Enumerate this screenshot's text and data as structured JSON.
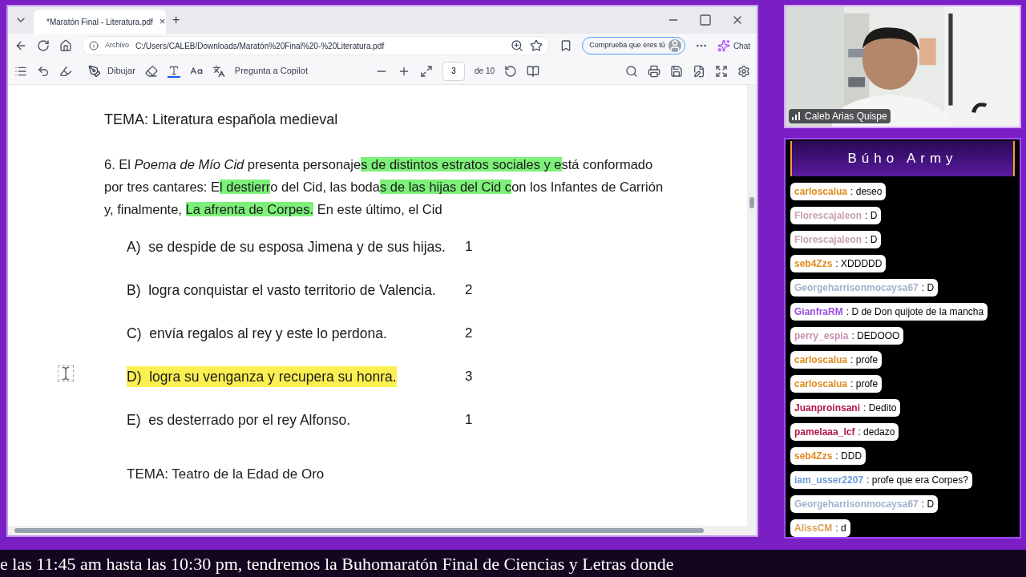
{
  "browser": {
    "tab": {
      "title": "*Maratón Final - Literatura.pdf",
      "close": "×"
    },
    "new_tab": "+",
    "address": {
      "label": "Archivo",
      "url": "C:/Users/CALEB/Downloads/Maratón%20Final%20-%20Literatura.pdf"
    },
    "verify_button": "Comprueba que eres tú",
    "chat_button": "Chat"
  },
  "pdf_toolbar": {
    "draw": "Dibujar",
    "copilot": "Pregunta a Copilot",
    "page": "3",
    "page_total": "de 10"
  },
  "document": {
    "heading": "TEMA: Literatura española medieval",
    "question_lines": [
      [
        {
          "text": "6. El ",
          "italic": false,
          "highlight": false
        },
        {
          "text": "Poema de Mío Cid",
          "italic": true,
          "highlight": false
        },
        {
          "text": " presenta personaje",
          "italic": false,
          "highlight": false
        },
        {
          "text": "s de distintos estratos sociales y e",
          "italic": false,
          "highlight": true
        },
        {
          "text": "stá conformado",
          "italic": false,
          "highlight": false
        }
      ],
      [
        {
          "text": "por tres cantares: E",
          "italic": false,
          "highlight": false
        },
        {
          "text": "l destierr",
          "italic": false,
          "highlight": true
        },
        {
          "text": "o del Cid, las boda",
          "italic": false,
          "highlight": false
        },
        {
          "text": "s de las hijas del Cid c",
          "italic": false,
          "highlight": true
        },
        {
          "text": "on los Infantes de Carrión",
          "italic": false,
          "highlight": false
        }
      ],
      [
        {
          "text": "y, finalmente, ",
          "italic": false,
          "highlight": false
        },
        {
          "text": "La afrenta de Corpes.",
          "italic": false,
          "highlight": true
        },
        {
          "text": " En este último, el Cid",
          "italic": false,
          "highlight": false
        }
      ]
    ],
    "options": [
      {
        "letter": "A)",
        "text": "se despide de su esposa Jimena y de sus hijas.",
        "count": "1",
        "highlight": false
      },
      {
        "letter": "B)",
        "text": "logra conquistar el vasto territorio de Valencia.",
        "count": "2",
        "highlight": false
      },
      {
        "letter": "C)",
        "text": "envía regalos al rey y este lo perdona.",
        "count": "2",
        "highlight": false
      },
      {
        "letter": "D)",
        "text": "logra su venganza y recupera su honra.",
        "count": "3",
        "highlight": true
      },
      {
        "letter": "E)",
        "text": "es desterrado por el rey Alfonso.",
        "count": "1",
        "highlight": false
      }
    ],
    "next_heading": "TEMA: Teatro de la Edad de Oro"
  },
  "webcam": {
    "name": "Caleb Arias Quispe"
  },
  "chat": {
    "title": "Búho Army",
    "separator": ":",
    "messages": [
      {
        "user": "carloscalua",
        "color": "#e08a1e",
        "text": "deseo"
      },
      {
        "user": "Florescajaleon",
        "color": "#c9a0b8",
        "text": "D"
      },
      {
        "user": "Florescajaleon",
        "color": "#c9a0b8",
        "text": "D"
      },
      {
        "user": "seb4Zzs",
        "color": "#e08a1e",
        "text": "XDDDDD"
      },
      {
        "user": "Georgeharrisonmocaysa67",
        "color": "#9fb3cf",
        "text": "D"
      },
      {
        "user": "GianfraRM",
        "color": "#9a4fe0",
        "text": "D de Don quijote de la mancha"
      },
      {
        "user": "perry_espia",
        "color": "#c98fb0",
        "text": "DEDOOO"
      },
      {
        "user": "carloscalua",
        "color": "#e08a1e",
        "text": "profe"
      },
      {
        "user": "carloscalua",
        "color": "#e08a1e",
        "text": "profe"
      },
      {
        "user": "Juanproinsani",
        "color": "#b0184a",
        "text": "Dedito"
      },
      {
        "user": "pamelaaa_lcf",
        "color": "#b0184a",
        "text": "dedazo"
      },
      {
        "user": "seb4Zzs",
        "color": "#e08a1e",
        "text": "DDD"
      },
      {
        "user": "iam_usser2207",
        "color": "#6d9ad6",
        "text": "profe que era Corpes?"
      },
      {
        "user": "Georgeharrisonmocaysa67",
        "color": "#9fb3cf",
        "text": "D"
      },
      {
        "user": "AlissCM",
        "color": "#d9a05a",
        "text": "d"
      }
    ]
  },
  "ticker": "e las 11:45 am hasta las 10:30 pm, tendremos la Buhomaratón Final de Ciencias y Letras donde"
}
